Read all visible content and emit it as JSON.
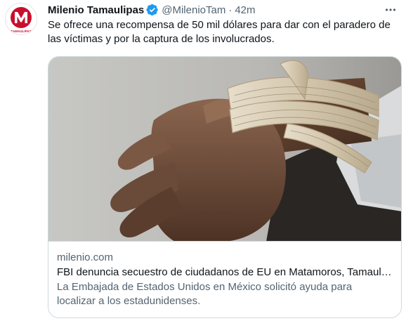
{
  "author": {
    "name": "Milenio Tamaulipas",
    "handle": "@MilenioTam",
    "separator": "·",
    "time": "42m",
    "avatar_icon": "milenio-logo",
    "avatar_text": "TAMAULIPAS",
    "verified_icon": "verified-badge-icon",
    "verified_color": "#1d9bf0"
  },
  "tweet": {
    "text": "Se ofrece una recompensa de 50 mil dólares para dar con el paradero de las víctimas y por la captura de los involucrados."
  },
  "card": {
    "image_description_icon": "photo",
    "domain": "milenio.com",
    "title": "FBI denuncia secuestro de ciudadanos de EU en Matamoros, Tamaulipas",
    "description": "La Embajada de Estados Unidos en México solicitó ayuda para localizar a los estadunidenses."
  },
  "colors": {
    "text_primary": "#0f1419",
    "text_secondary": "#536471",
    "border": "#cfd9de",
    "brand_red": "#c8102e"
  }
}
